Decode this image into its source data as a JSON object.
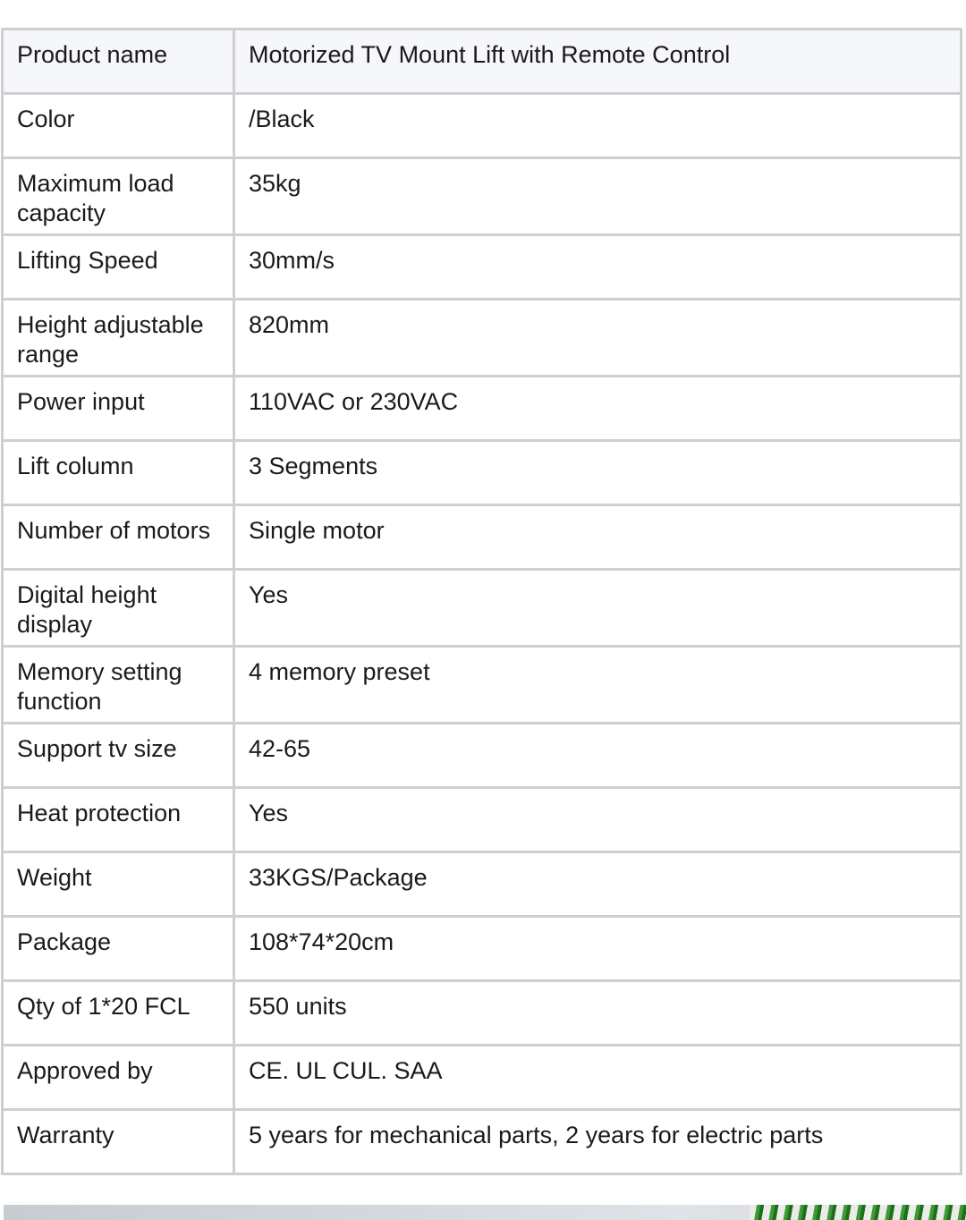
{
  "specs": [
    {
      "label": "Product name",
      "value": "Motorized TV Mount Lift with Remote Control"
    },
    {
      "label": "Color",
      "value": "/Black"
    },
    {
      "label": "Maximum load capacity",
      "value": "35kg"
    },
    {
      "label": "Lifting Speed",
      "value": "30mm/s"
    },
    {
      "label": "Height adjustable range",
      "value": "820mm"
    },
    {
      "label": "Power input",
      "value": "110VAC or 230VAC"
    },
    {
      "label": "Lift column",
      "value": "3 Segments"
    },
    {
      "label": "Number of motors",
      "value": "Single motor"
    },
    {
      "label": "Digital height display",
      "value": "Yes"
    },
    {
      "label": "Memory setting function",
      "value": "4 memory preset"
    },
    {
      "label": "Support tv size",
      "value": "42-65"
    },
    {
      "label": "Heat protection",
      "value": "Yes"
    },
    {
      "label": "Weight",
      "value": "33KGS/Package"
    },
    {
      "label": "Package",
      "value": "108*74*20cm"
    },
    {
      "label": "Qty of 1*20 FCL",
      "value": "550 units"
    },
    {
      "label": "Approved by",
      "value": "CE. UL CUL. SAA"
    },
    {
      "label": "Warranty",
      "value": "5 years for mechanical parts, 2 years for electric parts"
    }
  ]
}
